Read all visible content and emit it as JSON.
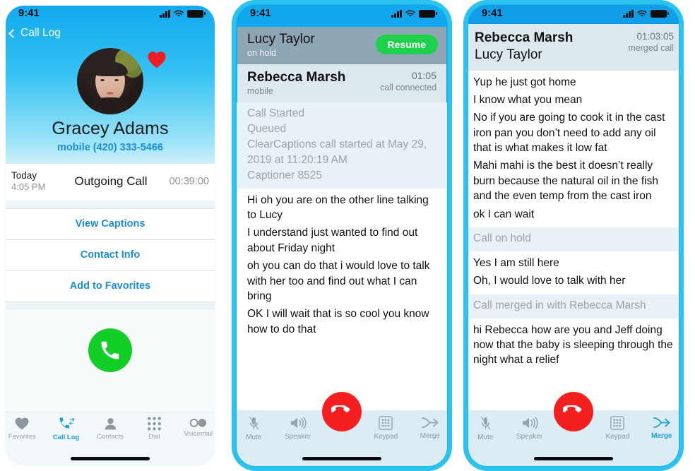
{
  "meta": {
    "accent_blue": "#1a9fe0",
    "header_blue": "#12a8ef",
    "green": "#12ce27",
    "resume_green": "#1ed14a",
    "end_red": "#f42020",
    "grey_text": "#8b9196"
  },
  "statusbar": {
    "time": "9:41",
    "signal_icon": "cellular-bars-icon",
    "wifi_icon": "wifi-icon",
    "battery_icon": "battery-full-icon"
  },
  "screen1": {
    "back_link": "Call Log",
    "back_icon": "chevron-left-icon",
    "avatar_name": "avatar",
    "favorite_icon": "heart-icon",
    "contact_name": "Gracey Adams",
    "contact_phone": "mobile (420) 333-5466",
    "call_row": {
      "day": "Today",
      "time": "4:05 PM",
      "type": "Outgoing Call",
      "duration": "00:39:00"
    },
    "actions": [
      {
        "label": "View Captions",
        "name": "view-captions-button"
      },
      {
        "label": "Contact Info",
        "name": "contact-info-button"
      },
      {
        "label": "Add to Favorites",
        "name": "add-to-favorites-button"
      }
    ],
    "call_button_icon": "phone-handset-icon",
    "tabs": [
      {
        "label": "Favorites",
        "icon": "heart-icon",
        "active": false
      },
      {
        "label": "Call Log",
        "icon": "call-log-icon",
        "active": true
      },
      {
        "label": "Contacts",
        "icon": "person-icon",
        "active": false
      },
      {
        "label": "Dial",
        "icon": "keypad-dots-icon",
        "active": false
      },
      {
        "label": "Voicemail",
        "icon": "voicemail-icon",
        "active": false
      }
    ]
  },
  "screen2": {
    "hold_card": {
      "name": "Lucy Taylor",
      "status": "on hold",
      "resume_label": "Resume"
    },
    "active_card": {
      "name": "Rebecca Marsh",
      "line_type": "mobile",
      "timer": "01:05",
      "status": "call connected"
    },
    "system_lines": [
      "Call Started",
      "Queued",
      "ClearCaptions call started at May 29, 2019 at 11:20:19 AM",
      "Captioner 8525"
    ],
    "caption_lines": [
      "Hi oh you are on the other line talking to Lucy",
      "I understand just wanted to find out about Friday night",
      "oh you can do that i would love to talk with her too and find out what I can bring",
      "OK I will wait that is so cool you know how to do that"
    ],
    "toolbar": [
      {
        "label": "Mute",
        "icon": "microphone-muted-icon",
        "active": false
      },
      {
        "label": "Speaker",
        "icon": "speaker-icon",
        "active": false
      },
      {
        "label": "Keypad",
        "icon": "keypad-grid-icon",
        "active": false
      },
      {
        "label": "Merge",
        "icon": "merge-arrow-icon",
        "active": false
      }
    ],
    "end_call_icon": "end-call-handset-icon"
  },
  "screen3": {
    "header": {
      "name_primary": "Rebecca Marsh",
      "name_secondary": "Lucy Taylor",
      "timer": "01:03:05",
      "status": "merged call"
    },
    "blocks": [
      {
        "kind": "captions",
        "lines": [
          "Yup he just got home",
          "I know what you mean",
          "No if you are going to cook it in the cast iron pan you don’t need to add any oil that is what makes it low fat",
          "Mahi mahi is the best it doesn’t really burn because the natural oil in the fish and the even temp from the cast iron",
          "ok I can wait"
        ]
      },
      {
        "kind": "system",
        "lines": [
          "Call on hold"
        ]
      },
      {
        "kind": "captions",
        "lines": [
          "Yes I am still here",
          "Oh, I would love to talk with her"
        ]
      },
      {
        "kind": "system",
        "lines": [
          "Call merged in with Rebecca Marsh"
        ]
      },
      {
        "kind": "captions",
        "lines": [
          "hi Rebecca how are you and Jeff doing now that the baby is sleeping through the night what a relief"
        ]
      }
    ],
    "toolbar": [
      {
        "label": "Mute",
        "icon": "microphone-muted-icon",
        "active": false
      },
      {
        "label": "Speaker",
        "icon": "speaker-icon",
        "active": false
      },
      {
        "label": "Keypad",
        "icon": "keypad-grid-icon",
        "active": false
      },
      {
        "label": "Merge",
        "icon": "merge-arrow-icon",
        "active": true
      }
    ],
    "end_call_icon": "end-call-handset-icon"
  }
}
